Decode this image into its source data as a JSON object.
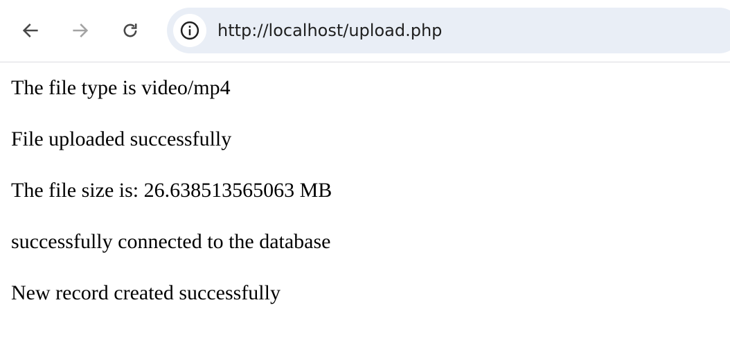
{
  "browser": {
    "back_icon": "arrow-left-icon",
    "forward_icon": "arrow-right-icon",
    "reload_icon": "reload-icon",
    "site_info_icon": "info-icon",
    "url": "http://localhost/upload.php"
  },
  "page": {
    "lines": [
      "The file type is video/mp4",
      "File uploaded successfully",
      "The file size is: 26.638513565063 MB",
      "successfully connected to the database",
      "New record created successfully"
    ]
  }
}
